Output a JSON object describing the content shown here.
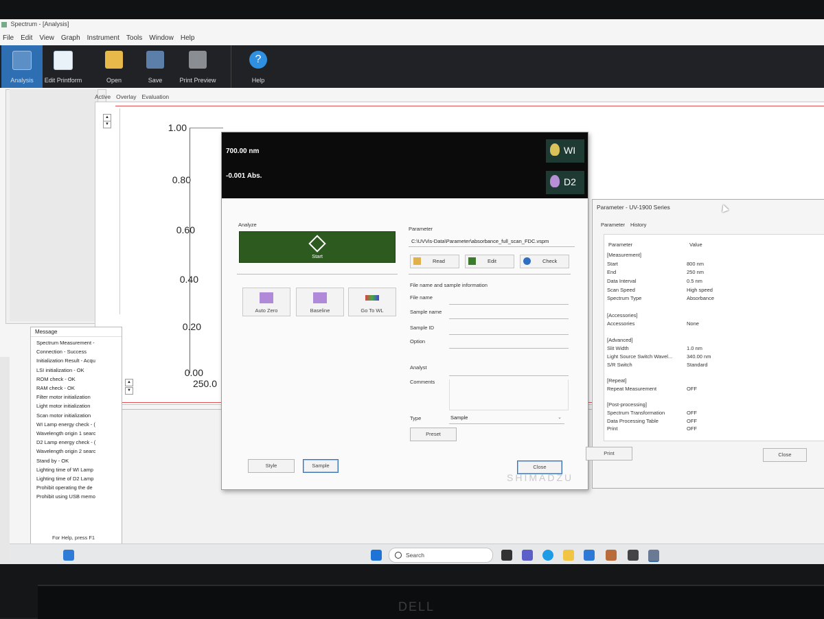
{
  "window": {
    "title": "Spectrum - [Analysis]"
  },
  "menu": [
    "File",
    "Edit",
    "View",
    "Graph",
    "Instrument",
    "Tools",
    "Window",
    "Help"
  ],
  "toolbar": {
    "analysis": "Analysis",
    "edit_printform": "Edit Printform",
    "open": "Open",
    "save": "Save",
    "print_preview": "Print Preview",
    "help": "Help"
  },
  "graph": {
    "tabs": [
      "Active",
      "Overlay",
      "Evaluation"
    ],
    "y_ticks": [
      "1.00",
      "0.80",
      "0.60",
      "0.40",
      "0.20",
      "0.00"
    ],
    "x_first_tick": "250.0"
  },
  "messages": {
    "header": "Message",
    "items": [
      "Spectrum Measurement -",
      "Connection - Success",
      "Initialization Result - Acqu",
      "LSI initialization - OK",
      "ROM check - OK",
      "RAM check - OK",
      "Filter motor initialization",
      "Light motor initialization",
      "Scan motor initialization",
      "WI Lamp energy check - (",
      "Wavelength origin 1 searc",
      "D2 Lamp energy check - (",
      "Wavelength origin 2 searc",
      "Stand by - OK",
      "Lighting time of WI Lamp",
      "Lighting time of D2 Lamp",
      "Prohibit operating the de",
      "Prohibit using USB memo"
    ]
  },
  "status_bar": "For Help, press F1",
  "analyze_dialog": {
    "wavelength": "700.00 nm",
    "absorbance": "-0.001 Abs.",
    "lamp_wi": "WI",
    "lamp_d2": "D2",
    "analyze_label": "Analyze",
    "start": "Start",
    "auto_zero": "Auto Zero",
    "baseline": "Baseline",
    "go_to_wl": "Go To WL",
    "parameter_label": "Parameter",
    "parameter_path": "C:\\UVVis-Data\\Parameter\\absorbance_full_scan_FDC.vspm",
    "read": "Read",
    "edit": "Edit",
    "check": "Check",
    "file_info_label": "File name and sample information",
    "file_name": "File name",
    "sample_name": "Sample name",
    "sample_id": "Sample ID",
    "option": "Option",
    "analyst": "Analyst",
    "comments": "Comments",
    "type_label": "Type",
    "type_value": "Sample",
    "preset": "Preset",
    "style": "Style",
    "sample": "Sample",
    "close": "Close"
  },
  "parameter_dialog": {
    "title": "Parameter - UV-1900 Series",
    "tabs": [
      "Parameter",
      "History"
    ],
    "col_param": "Parameter",
    "col_value": "Value",
    "rows": [
      {
        "k": "[Measurement]",
        "v": ""
      },
      {
        "k": "Start",
        "v": "800 nm"
      },
      {
        "k": "End",
        "v": "250 nm"
      },
      {
        "k": "Data Interval",
        "v": "0.5 nm"
      },
      {
        "k": "Scan Speed",
        "v": "High speed"
      },
      {
        "k": "Spectrum Type",
        "v": "Absorbance"
      },
      {
        "k": "[Accessories]",
        "v": ""
      },
      {
        "k": "Accessories",
        "v": "None"
      },
      {
        "k": "[Advanced]",
        "v": ""
      },
      {
        "k": "Slit Width",
        "v": "1.0 nm"
      },
      {
        "k": "Light Source Switch Wavel...",
        "v": "340.00 nm"
      },
      {
        "k": "S/R Switch",
        "v": "Standard"
      },
      {
        "k": "[Repeat]",
        "v": ""
      },
      {
        "k": "Repeat Measurement",
        "v": "OFF"
      },
      {
        "k": "[Post-processing]",
        "v": ""
      },
      {
        "k": "Spectrum Transformation",
        "v": "OFF"
      },
      {
        "k": "Data Processing Table",
        "v": "OFF"
      },
      {
        "k": "Print",
        "v": "OFF"
      }
    ],
    "print": "Print",
    "close": "Close"
  },
  "watermark": "SHIMADZU",
  "taskbar": {
    "search_placeholder": "Search"
  },
  "monitor_brand": "DELL",
  "colors": {
    "start_green": "#2c5a1f",
    "lamp_bg": "#1f3a33",
    "toolbar_bg": "#202225",
    "accent_blue": "#2e6fb3"
  }
}
